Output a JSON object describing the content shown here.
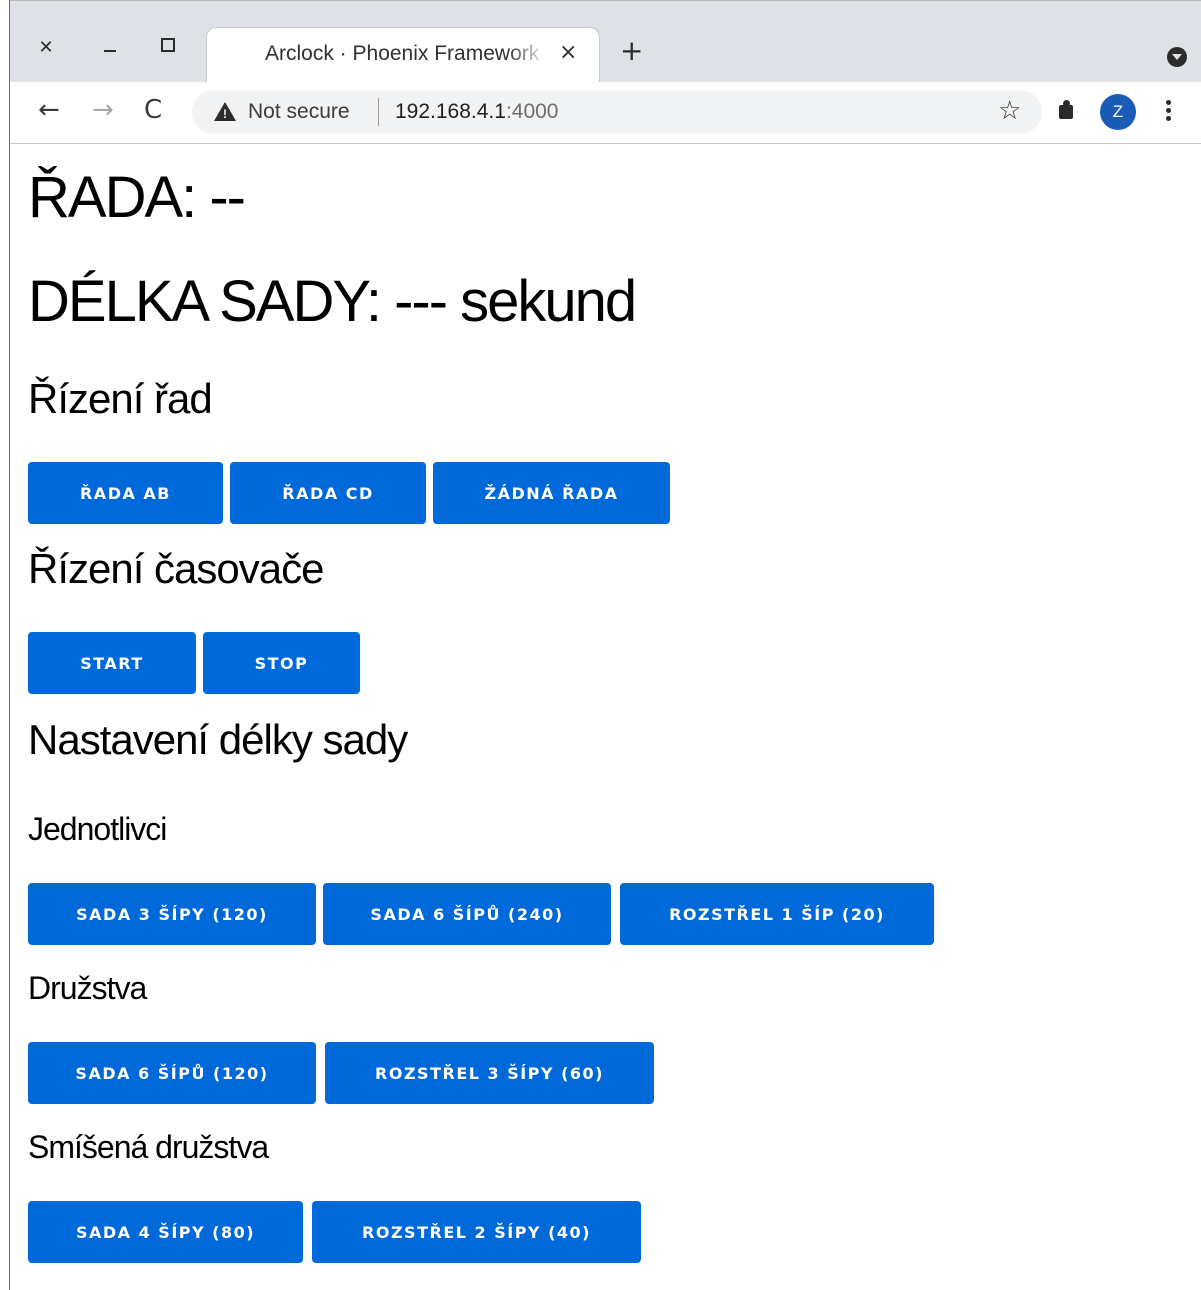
{
  "browser": {
    "tab_title": "Arclock · Phoenix Framework",
    "tab_close": "×",
    "new_tab": "+",
    "nav_back": "←",
    "nav_forward": "→",
    "nav_reload": "C",
    "security_label": "Not secure",
    "url_host": "192.168.4.1",
    "url_port": ":4000",
    "bookmark_star": "☆",
    "profile_initial": "Z",
    "window_close": "✕"
  },
  "status": {
    "rada_label": "ŘADA: --",
    "delka_label": "DÉLKA SADY: --- sekund"
  },
  "sections": {
    "rizeni_rad": {
      "title": "Řízení řad",
      "buttons": [
        "ŘADA AB",
        "ŘADA CD",
        "ŽÁDNÁ ŘADA"
      ]
    },
    "rizeni_casovace": {
      "title": "Řízení časovače",
      "buttons": [
        "START",
        "STOP"
      ]
    },
    "nastaveni": {
      "title": "Nastavení délky sady",
      "jednotlivci": {
        "title": "Jednotlivci",
        "buttons": [
          "SADA 3 ŠÍPY (120)",
          "SADA 6 ŠÍPŮ (240)",
          "ROZSTŘEL 1 ŠÍP (20)"
        ]
      },
      "druzstva": {
        "title": "Družstva",
        "buttons": [
          "SADA 6 ŠÍPŮ (120)",
          "ROZSTŘEL 3 ŠÍPY (60)"
        ]
      },
      "smisena": {
        "title": "Smíšená družstva",
        "buttons": [
          "SADA 4 ŠÍPY (80)",
          "ROZSTŘEL 2 ŠÍPY (40)"
        ]
      }
    }
  },
  "colors": {
    "button_bg": "#0069d9",
    "button_text": "#ffffff",
    "titlebar_bg": "#dee1e6"
  }
}
